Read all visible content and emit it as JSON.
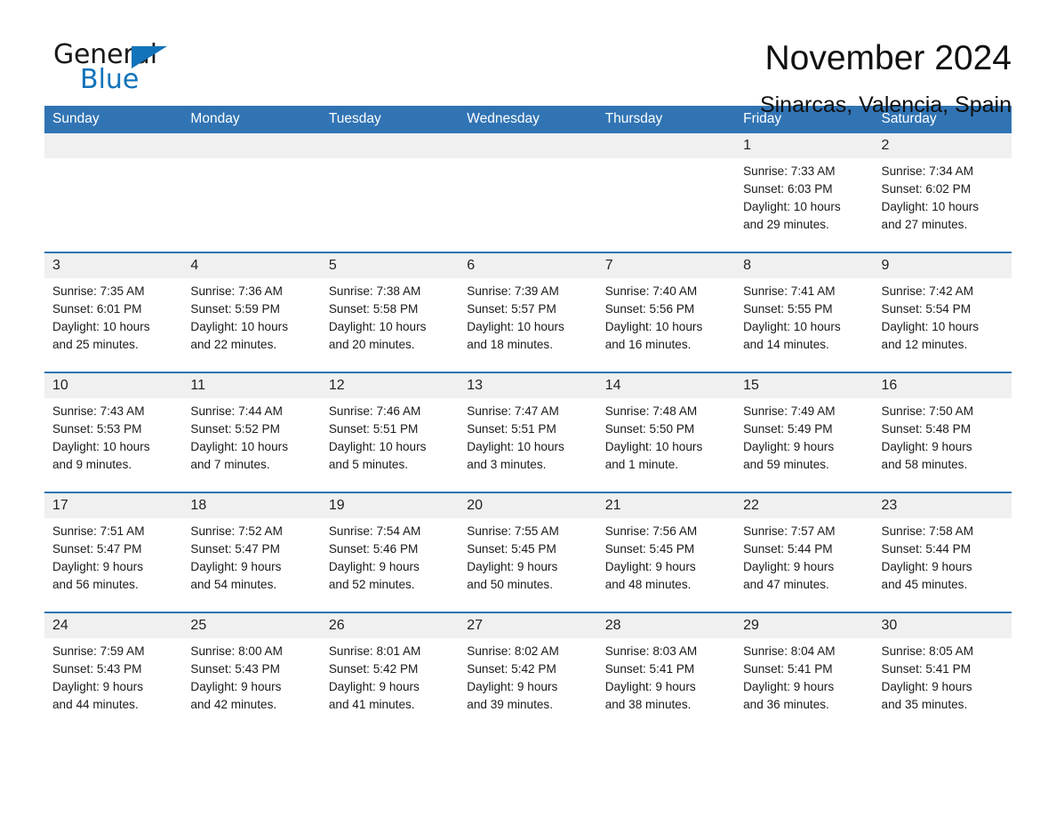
{
  "brand": {
    "name_part1": "General",
    "name_part2": "Blue",
    "accent_color": "#1273ba",
    "triangle_icon": "triangle-icon"
  },
  "header": {
    "title": "November 2024",
    "subtitle": "Sinarcas, Valencia, Spain"
  },
  "colors": {
    "header_blue": "#3174b4",
    "daynum_band": "#f0f0f0",
    "text": "#1a1a1a"
  },
  "calendar": {
    "weekday_headers": [
      "Sunday",
      "Monday",
      "Tuesday",
      "Wednesday",
      "Thursday",
      "Friday",
      "Saturday"
    ],
    "weeks": [
      [
        {
          "day": "",
          "empty": true
        },
        {
          "day": "",
          "empty": true
        },
        {
          "day": "",
          "empty": true
        },
        {
          "day": "",
          "empty": true
        },
        {
          "day": "",
          "empty": true
        },
        {
          "day": "1",
          "sunrise": "Sunrise: 7:33 AM",
          "sunset": "Sunset: 6:03 PM",
          "daylight_line1": "Daylight: 10 hours",
          "daylight_line2": "and 29 minutes."
        },
        {
          "day": "2",
          "sunrise": "Sunrise: 7:34 AM",
          "sunset": "Sunset: 6:02 PM",
          "daylight_line1": "Daylight: 10 hours",
          "daylight_line2": "and 27 minutes."
        }
      ],
      [
        {
          "day": "3",
          "sunrise": "Sunrise: 7:35 AM",
          "sunset": "Sunset: 6:01 PM",
          "daylight_line1": "Daylight: 10 hours",
          "daylight_line2": "and 25 minutes."
        },
        {
          "day": "4",
          "sunrise": "Sunrise: 7:36 AM",
          "sunset": "Sunset: 5:59 PM",
          "daylight_line1": "Daylight: 10 hours",
          "daylight_line2": "and 22 minutes."
        },
        {
          "day": "5",
          "sunrise": "Sunrise: 7:38 AM",
          "sunset": "Sunset: 5:58 PM",
          "daylight_line1": "Daylight: 10 hours",
          "daylight_line2": "and 20 minutes."
        },
        {
          "day": "6",
          "sunrise": "Sunrise: 7:39 AM",
          "sunset": "Sunset: 5:57 PM",
          "daylight_line1": "Daylight: 10 hours",
          "daylight_line2": "and 18 minutes."
        },
        {
          "day": "7",
          "sunrise": "Sunrise: 7:40 AM",
          "sunset": "Sunset: 5:56 PM",
          "daylight_line1": "Daylight: 10 hours",
          "daylight_line2": "and 16 minutes."
        },
        {
          "day": "8",
          "sunrise": "Sunrise: 7:41 AM",
          "sunset": "Sunset: 5:55 PM",
          "daylight_line1": "Daylight: 10 hours",
          "daylight_line2": "and 14 minutes."
        },
        {
          "day": "9",
          "sunrise": "Sunrise: 7:42 AM",
          "sunset": "Sunset: 5:54 PM",
          "daylight_line1": "Daylight: 10 hours",
          "daylight_line2": "and 12 minutes."
        }
      ],
      [
        {
          "day": "10",
          "sunrise": "Sunrise: 7:43 AM",
          "sunset": "Sunset: 5:53 PM",
          "daylight_line1": "Daylight: 10 hours",
          "daylight_line2": "and 9 minutes."
        },
        {
          "day": "11",
          "sunrise": "Sunrise: 7:44 AM",
          "sunset": "Sunset: 5:52 PM",
          "daylight_line1": "Daylight: 10 hours",
          "daylight_line2": "and 7 minutes."
        },
        {
          "day": "12",
          "sunrise": "Sunrise: 7:46 AM",
          "sunset": "Sunset: 5:51 PM",
          "daylight_line1": "Daylight: 10 hours",
          "daylight_line2": "and 5 minutes."
        },
        {
          "day": "13",
          "sunrise": "Sunrise: 7:47 AM",
          "sunset": "Sunset: 5:51 PM",
          "daylight_line1": "Daylight: 10 hours",
          "daylight_line2": "and 3 minutes."
        },
        {
          "day": "14",
          "sunrise": "Sunrise: 7:48 AM",
          "sunset": "Sunset: 5:50 PM",
          "daylight_line1": "Daylight: 10 hours",
          "daylight_line2": "and 1 minute."
        },
        {
          "day": "15",
          "sunrise": "Sunrise: 7:49 AM",
          "sunset": "Sunset: 5:49 PM",
          "daylight_line1": "Daylight: 9 hours",
          "daylight_line2": "and 59 minutes."
        },
        {
          "day": "16",
          "sunrise": "Sunrise: 7:50 AM",
          "sunset": "Sunset: 5:48 PM",
          "daylight_line1": "Daylight: 9 hours",
          "daylight_line2": "and 58 minutes."
        }
      ],
      [
        {
          "day": "17",
          "sunrise": "Sunrise: 7:51 AM",
          "sunset": "Sunset: 5:47 PM",
          "daylight_line1": "Daylight: 9 hours",
          "daylight_line2": "and 56 minutes."
        },
        {
          "day": "18",
          "sunrise": "Sunrise: 7:52 AM",
          "sunset": "Sunset: 5:47 PM",
          "daylight_line1": "Daylight: 9 hours",
          "daylight_line2": "and 54 minutes."
        },
        {
          "day": "19",
          "sunrise": "Sunrise: 7:54 AM",
          "sunset": "Sunset: 5:46 PM",
          "daylight_line1": "Daylight: 9 hours",
          "daylight_line2": "and 52 minutes."
        },
        {
          "day": "20",
          "sunrise": "Sunrise: 7:55 AM",
          "sunset": "Sunset: 5:45 PM",
          "daylight_line1": "Daylight: 9 hours",
          "daylight_line2": "and 50 minutes."
        },
        {
          "day": "21",
          "sunrise": "Sunrise: 7:56 AM",
          "sunset": "Sunset: 5:45 PM",
          "daylight_line1": "Daylight: 9 hours",
          "daylight_line2": "and 48 minutes."
        },
        {
          "day": "22",
          "sunrise": "Sunrise: 7:57 AM",
          "sunset": "Sunset: 5:44 PM",
          "daylight_line1": "Daylight: 9 hours",
          "daylight_line2": "and 47 minutes."
        },
        {
          "day": "23",
          "sunrise": "Sunrise: 7:58 AM",
          "sunset": "Sunset: 5:44 PM",
          "daylight_line1": "Daylight: 9 hours",
          "daylight_line2": "and 45 minutes."
        }
      ],
      [
        {
          "day": "24",
          "sunrise": "Sunrise: 7:59 AM",
          "sunset": "Sunset: 5:43 PM",
          "daylight_line1": "Daylight: 9 hours",
          "daylight_line2": "and 44 minutes."
        },
        {
          "day": "25",
          "sunrise": "Sunrise: 8:00 AM",
          "sunset": "Sunset: 5:43 PM",
          "daylight_line1": "Daylight: 9 hours",
          "daylight_line2": "and 42 minutes."
        },
        {
          "day": "26",
          "sunrise": "Sunrise: 8:01 AM",
          "sunset": "Sunset: 5:42 PM",
          "daylight_line1": "Daylight: 9 hours",
          "daylight_line2": "and 41 minutes."
        },
        {
          "day": "27",
          "sunrise": "Sunrise: 8:02 AM",
          "sunset": "Sunset: 5:42 PM",
          "daylight_line1": "Daylight: 9 hours",
          "daylight_line2": "and 39 minutes."
        },
        {
          "day": "28",
          "sunrise": "Sunrise: 8:03 AM",
          "sunset": "Sunset: 5:41 PM",
          "daylight_line1": "Daylight: 9 hours",
          "daylight_line2": "and 38 minutes."
        },
        {
          "day": "29",
          "sunrise": "Sunrise: 8:04 AM",
          "sunset": "Sunset: 5:41 PM",
          "daylight_line1": "Daylight: 9 hours",
          "daylight_line2": "and 36 minutes."
        },
        {
          "day": "30",
          "sunrise": "Sunrise: 8:05 AM",
          "sunset": "Sunset: 5:41 PM",
          "daylight_line1": "Daylight: 9 hours",
          "daylight_line2": "and 35 minutes."
        }
      ]
    ]
  }
}
